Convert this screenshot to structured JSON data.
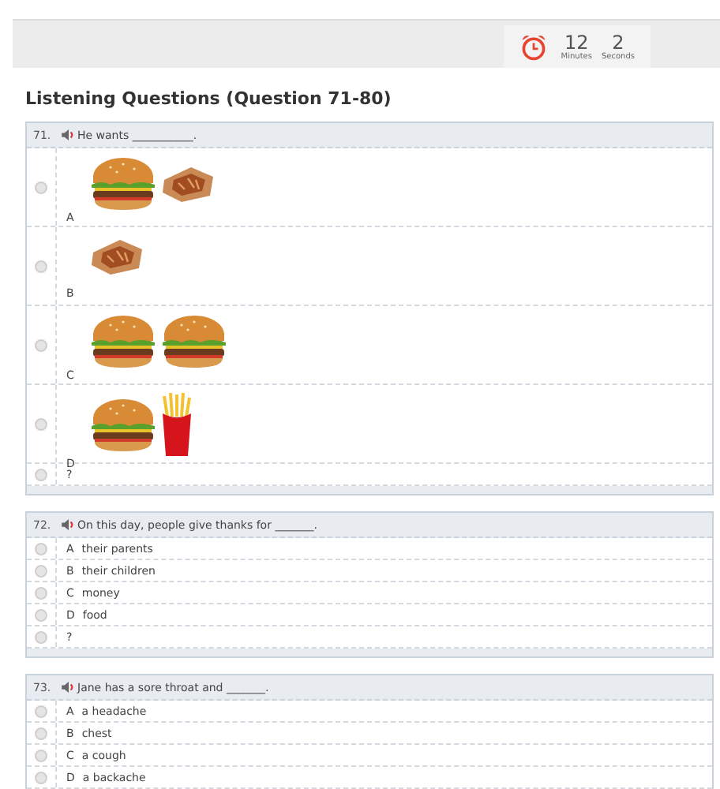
{
  "timer": {
    "minutes": "12",
    "minutes_label": "Minutes",
    "seconds": "2",
    "seconds_label": "Seconds"
  },
  "section_title": "Listening Questions (Question 71-80)",
  "questions": [
    {
      "number": "71.",
      "prompt": "He wants ___________.",
      "options": [
        {
          "kind": "image",
          "letter": "A",
          "selected": false,
          "pictures": [
            {
              "kind": "burger"
            },
            {
              "kind": "pie"
            }
          ]
        },
        {
          "kind": "image",
          "letter": "B",
          "selected": false,
          "pictures": [
            {
              "kind": "pie"
            }
          ]
        },
        {
          "kind": "image",
          "letter": "C",
          "selected": false,
          "pictures": [
            {
              "kind": "burger"
            },
            {
              "kind": "burger"
            }
          ]
        },
        {
          "kind": "image",
          "letter": "D",
          "selected": false,
          "pictures": [
            {
              "kind": "burger"
            },
            {
              "kind": "fries"
            }
          ]
        },
        {
          "kind": "text",
          "letter": "?",
          "selected": false
        }
      ]
    },
    {
      "number": "72.",
      "prompt": "On this day, people give thanks for _______.",
      "options": [
        {
          "kind": "text",
          "letter": "A",
          "text": "their parents",
          "selected": false
        },
        {
          "kind": "text",
          "letter": "B",
          "text": "their children",
          "selected": false
        },
        {
          "kind": "text",
          "letter": "C",
          "text": "money",
          "selected": false
        },
        {
          "kind": "text",
          "letter": "D",
          "text": "food",
          "selected": false
        },
        {
          "kind": "text",
          "letter": "?",
          "selected": false
        }
      ]
    },
    {
      "number": "73.",
      "prompt": "Jane has a sore throat and _______.",
      "options": [
        {
          "kind": "text",
          "letter": "A",
          "text": "a headache",
          "selected": false
        },
        {
          "kind": "text",
          "letter": "B",
          "text": "chest",
          "selected": false
        },
        {
          "kind": "text",
          "letter": "C",
          "text": "a cough",
          "selected": false
        },
        {
          "kind": "text",
          "letter": "D",
          "text": "a backache",
          "selected": false
        }
      ]
    }
  ]
}
